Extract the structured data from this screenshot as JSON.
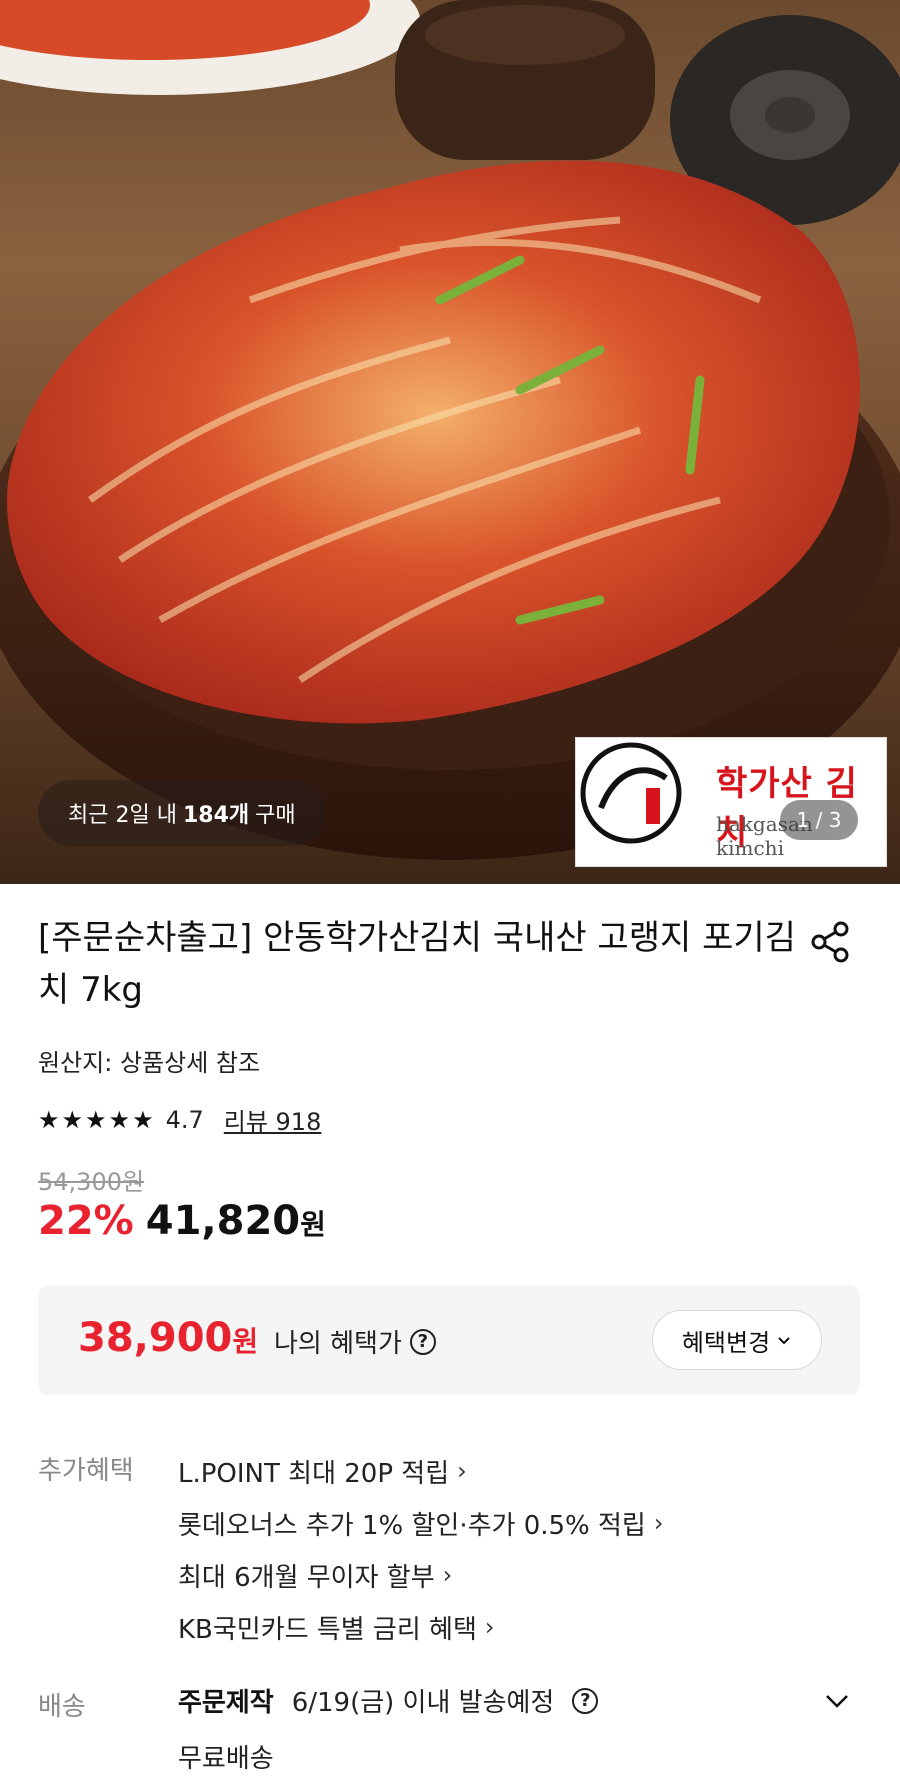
{
  "hero": {
    "recent_prefix": "최근 2일 내",
    "recent_count": "184개",
    "recent_suffix": "구매",
    "logo_name": "학가산 김치",
    "logo_sub": "hakgasan kimchi",
    "image_counter": "1 / 3"
  },
  "product": {
    "title": "[주문순차출고] 안동학가산김치 국내산 고랭지 포기김치 7kg",
    "origin": "원산지: 상품상세 참조",
    "rating": "4.7",
    "review_link": "리뷰 918",
    "original_price": "54,300원",
    "discount": "22%",
    "price": "41,820",
    "price_unit": "원"
  },
  "benefit": {
    "price": "38,900",
    "price_unit": "원",
    "label": "나의 혜택가",
    "change_button": "혜택변경"
  },
  "extra_benefits": {
    "label": "추가혜택",
    "items": [
      "L.POINT 최대 20P 적립",
      "롯데오너스 추가 1% 할인·추가 0.5% 적립",
      "최대 6개월 무이자 할부",
      "KB국민카드 특별 금리 혜택"
    ]
  },
  "shipping": {
    "label": "배송",
    "type": "주문제작",
    "date": "6/19(금) 이내 발송예정",
    "fee": "무료배송"
  },
  "colors": {
    "accent_red": "#e8222e",
    "benefit_bg": "#f5f5f5",
    "muted": "#888888"
  },
  "icons": [
    "share-icon",
    "help-circle-icon",
    "chevron-down-icon",
    "chevron-right-icon",
    "star-icon"
  ]
}
